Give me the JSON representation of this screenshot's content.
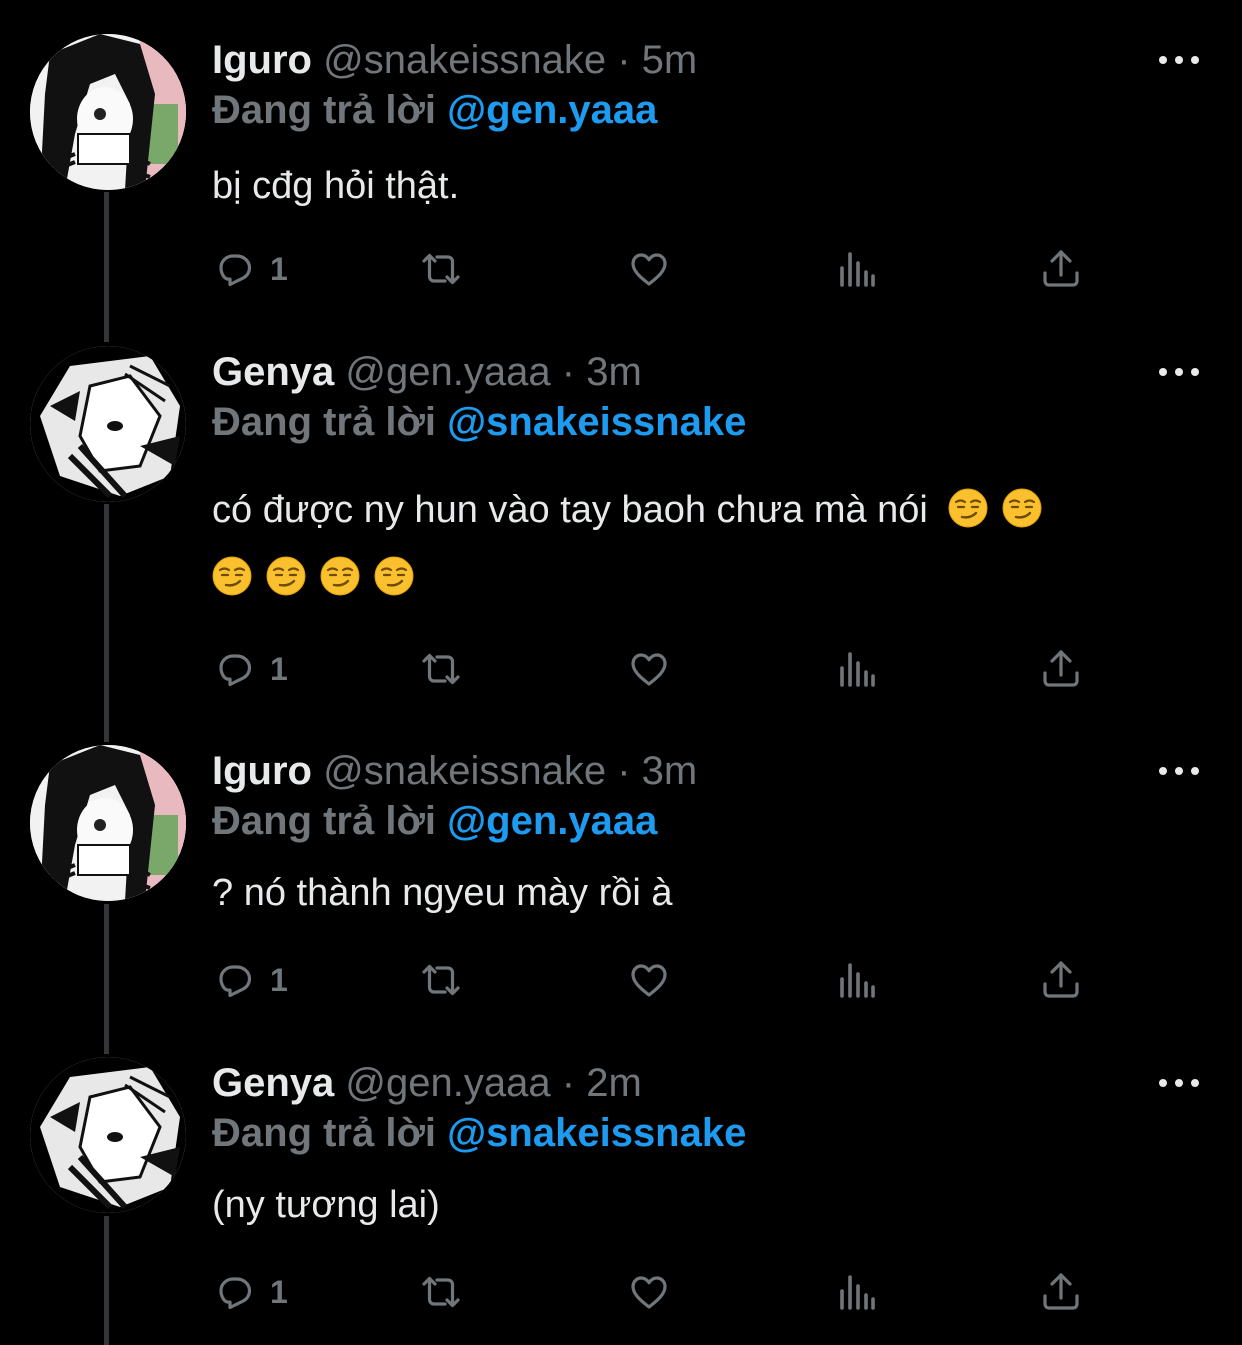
{
  "tweets": [
    {
      "name": "Iguro",
      "handle": "@snakeissnake",
      "dot": "·",
      "time": "5m",
      "reply_label": "Đang trả lời",
      "reply_user": "@gen.yaaa",
      "text": "bị cđg hỏi thật.",
      "emojis": [],
      "reply_count": "1",
      "avatar": "iguro-avatar"
    },
    {
      "name": "Genya",
      "handle": "@gen.yaaa",
      "dot": "·",
      "time": "3m",
      "reply_label": "Đang trả lời",
      "reply_user": "@snakeissnake",
      "text": "có được ny hun vào tay baoh chưa mà nói",
      "emojis": [
        "smirking-face",
        "smirking-face",
        "smirking-face",
        "smirking-face",
        "smirking-face",
        "smirking-face"
      ],
      "reply_count": "1",
      "avatar": "genya-avatar"
    },
    {
      "name": "Iguro",
      "handle": "@snakeissnake",
      "dot": "·",
      "time": "3m",
      "reply_label": "Đang trả lời",
      "reply_user": "@gen.yaaa",
      "text": "? nó thành ngyeu mày rồi à",
      "emojis": [],
      "reply_count": "1",
      "avatar": "iguro-avatar"
    },
    {
      "name": "Genya",
      "handle": "@gen.yaaa",
      "dot": "·",
      "time": "2m",
      "reply_label": "Đang trả lời",
      "reply_user": "@snakeissnake",
      "text": "(ny tương lai)",
      "emojis": [],
      "reply_count": "1",
      "avatar": "genya-avatar"
    }
  ],
  "colors": {
    "background": "#000000",
    "text": "#e7e9ea",
    "muted": "#71767b",
    "accent": "#1d9bf0",
    "thread_line": "#333639"
  },
  "icons": [
    "reply-icon",
    "retweet-icon",
    "like-icon",
    "views-icon",
    "share-icon",
    "more-icon"
  ]
}
